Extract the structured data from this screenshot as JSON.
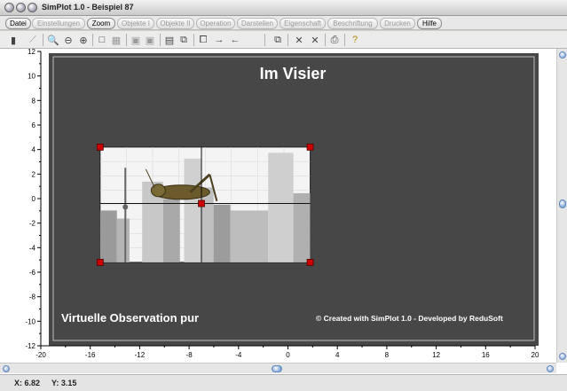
{
  "window": {
    "title": "SimPlot 1.0 - Beispiel 87"
  },
  "menu": {
    "items": [
      {
        "label": "Datei",
        "enabled": true
      },
      {
        "label": "Einstellungen",
        "enabled": false
      },
      {
        "label": "Zoom",
        "enabled": true
      },
      {
        "label": "Objekte I",
        "enabled": false
      },
      {
        "label": "Objekte II",
        "enabled": false
      },
      {
        "label": "Operation",
        "enabled": false
      },
      {
        "label": "Darstellen",
        "enabled": false
      },
      {
        "label": "Eigenschaft",
        "enabled": false
      },
      {
        "label": "Beschriftung",
        "enabled": false
      },
      {
        "label": "Drucken",
        "enabled": false
      },
      {
        "label": "Hilfe",
        "enabled": true
      }
    ]
  },
  "toolbar": {
    "icons": [
      "calculator-icon",
      "chart-icon",
      "zoom-icon",
      "zoom-out-icon",
      "zoom-in-icon",
      "square-icon",
      "grid-icon",
      "box-icon",
      "box2-icon",
      "table-icon",
      "frame-icon",
      "copy-icon",
      "arrow-right-icon",
      "arrow-left-icon",
      "pages-icon",
      "x-icon",
      "x2-icon",
      "printer-icon",
      "help-icon"
    ]
  },
  "plot": {
    "title": "Im Visier",
    "caption": "Virtuelle Observation pur",
    "credit": "© Created with SimPlot 1.0 - Developed by ReduSoft",
    "background_color": "#474747",
    "frame_color": "#ffffff",
    "marker_color": "#cc0000"
  },
  "chart_data": {
    "type": "scatter",
    "xlim": [
      -20,
      20
    ],
    "ylim": [
      -12,
      12
    ],
    "x_ticks": [
      -20,
      -16,
      -12,
      -8,
      -4,
      0,
      4,
      8,
      12,
      16,
      20
    ],
    "y_ticks": [
      12,
      10,
      8,
      6,
      4,
      2,
      0,
      -2,
      -4,
      -6,
      -8,
      -10,
      -12
    ],
    "markers": [
      {
        "x": -15.2,
        "y": 4.2
      },
      {
        "x": 1.8,
        "y": 4.2
      },
      {
        "x": -15.2,
        "y": -5.2
      },
      {
        "x": 1.8,
        "y": -5.2
      },
      {
        "x": -7.0,
        "y": -0.4
      }
    ],
    "image_region": {
      "x_min": -15.2,
      "x_max": 1.8,
      "y_min": -5.2,
      "y_max": 4.2
    },
    "crosshair": {
      "x": -7.0,
      "y": -0.4
    },
    "grid": false
  },
  "status": {
    "x_label": "X: 6.82",
    "y_label": "Y: 3.15"
  }
}
